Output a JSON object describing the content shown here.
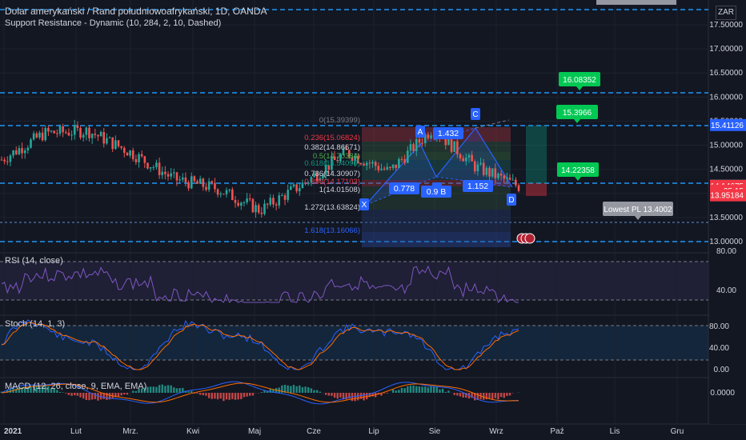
{
  "header": {
    "title": "Dolar amerykański / Rand południowoafrykański, 1D, OANDA",
    "indicator": "Support Resistance - Dynamic (10, 284, 2, 10, Dashed)"
  },
  "currency_badge": "ZAR",
  "price_axis": {
    "ticks": [
      "17.50000",
      "17.00000",
      "16.50000",
      "16.00000",
      "15.50000",
      "15.00000",
      "14.50000",
      "14.00000",
      "13.50000",
      "13.00000"
    ],
    "tick_values": [
      17.5,
      17.0,
      16.5,
      16.0,
      15.5,
      15.0,
      14.5,
      14.0,
      13.5,
      13.0
    ],
    "labels": [
      {
        "text": "15.41126",
        "value": 15.41126,
        "color": "#2962ff"
      },
      {
        "text": "14.15909",
        "value": 14.15909,
        "color": "#434651"
      },
      {
        "text": "14.14675",
        "value": 14.14675,
        "color": "#f23645"
      },
      {
        "text": "35:15",
        "value": 14.05,
        "color": "#f23645"
      },
      {
        "text": "13.95184",
        "value": 13.95184,
        "color": "#f23645"
      }
    ]
  },
  "x_axis": {
    "labels": [
      "2021",
      "Lut",
      "Mrz.",
      "Kwi",
      "Maj",
      "Cze",
      "Lip",
      "Sie",
      "Wrz",
      "Paź",
      "Lis",
      "Gru"
    ]
  },
  "support_resistance_levels": [
    17.75,
    16.08,
    15.41,
    14.16,
    13.5,
    12.55
  ],
  "callouts": [
    {
      "text": "16.08352",
      "color": "#00c853"
    },
    {
      "text": "15.3966",
      "color": "#00c853"
    },
    {
      "text": "14.22358",
      "color": "#00c853"
    },
    {
      "text": "Lowest PL 13.4002",
      "color": "#9598a1"
    }
  ],
  "fib_levels": [
    {
      "text": "0(15.39399)",
      "color": "#787b86"
    },
    {
      "text": "0.236(15.06824)",
      "color": "#f23645"
    },
    {
      "text": "0.382(14.86671)",
      "color": "#d1d4dc"
    },
    {
      "text": "0.5(14.70384)",
      "color": "#4caf50"
    },
    {
      "text": "0.618(14.54096)",
      "color": "#089981"
    },
    {
      "text": "0.786(14.30907)",
      "color": "#d1d4dc"
    },
    {
      "text": "0.886(14.17103)",
      "color": "#f23645"
    },
    {
      "text": "1(14.01508)",
      "color": "#d1d4dc"
    },
    {
      "text": "1.272(13.63824)",
      "color": "#d1d4dc"
    },
    {
      "text": "1.618(13.16066)",
      "color": "#2962ff"
    }
  ],
  "pattern_points": [
    {
      "label": "X",
      "value": 13.95
    },
    {
      "label": "A",
      "value": 14.9
    },
    {
      "label": "B",
      "value": 14.4
    },
    {
      "label": "C",
      "value": 15.39
    },
    {
      "label": "D",
      "value": 14.12
    }
  ],
  "ratios": [
    "0.778",
    "0.9 B",
    "1.432",
    "1.152"
  ],
  "panes": {
    "rsi": {
      "label": "RSI (14, close)",
      "ticks": [
        "80.00",
        "40.00"
      ]
    },
    "stoch": {
      "label": "Stoch (14, 1, 3)",
      "ticks": [
        "80.00",
        "40.00",
        "0.00"
      ]
    },
    "macd": {
      "label": "MACD (12, 26, close, 9, EMA, EMA)",
      "ticks": [
        "0.0000"
      ]
    }
  },
  "chart_data": {
    "type": "line",
    "title": "Dolar amerykański / Rand południowoafrykański, 1D, OANDA",
    "xlabel": "",
    "ylabel": "",
    "x": [
      "2021",
      "Lut",
      "Mrz.",
      "Kwi",
      "Maj",
      "Cze",
      "Lip",
      "Sie",
      "Wrz"
    ],
    "series": [
      {
        "values": [
          14.7,
          15.25,
          15.3,
          14.85,
          14.3,
          14.1,
          13.65,
          14.2,
          14.85,
          14.45,
          15.35,
          14.55,
          14.15
        ]
      }
    ],
    "ylim": [
      12.9,
      17.75
    ],
    "legend": "none",
    "grid": true
  },
  "colors": {
    "background": "#131722",
    "grid": "#1e222d",
    "up": "#26a69a",
    "down": "#ef5350",
    "sr_line": "#2196f3",
    "rsi": "#7e57c2",
    "stoch_k": "#2962ff",
    "stoch_d": "#ff6d00"
  }
}
